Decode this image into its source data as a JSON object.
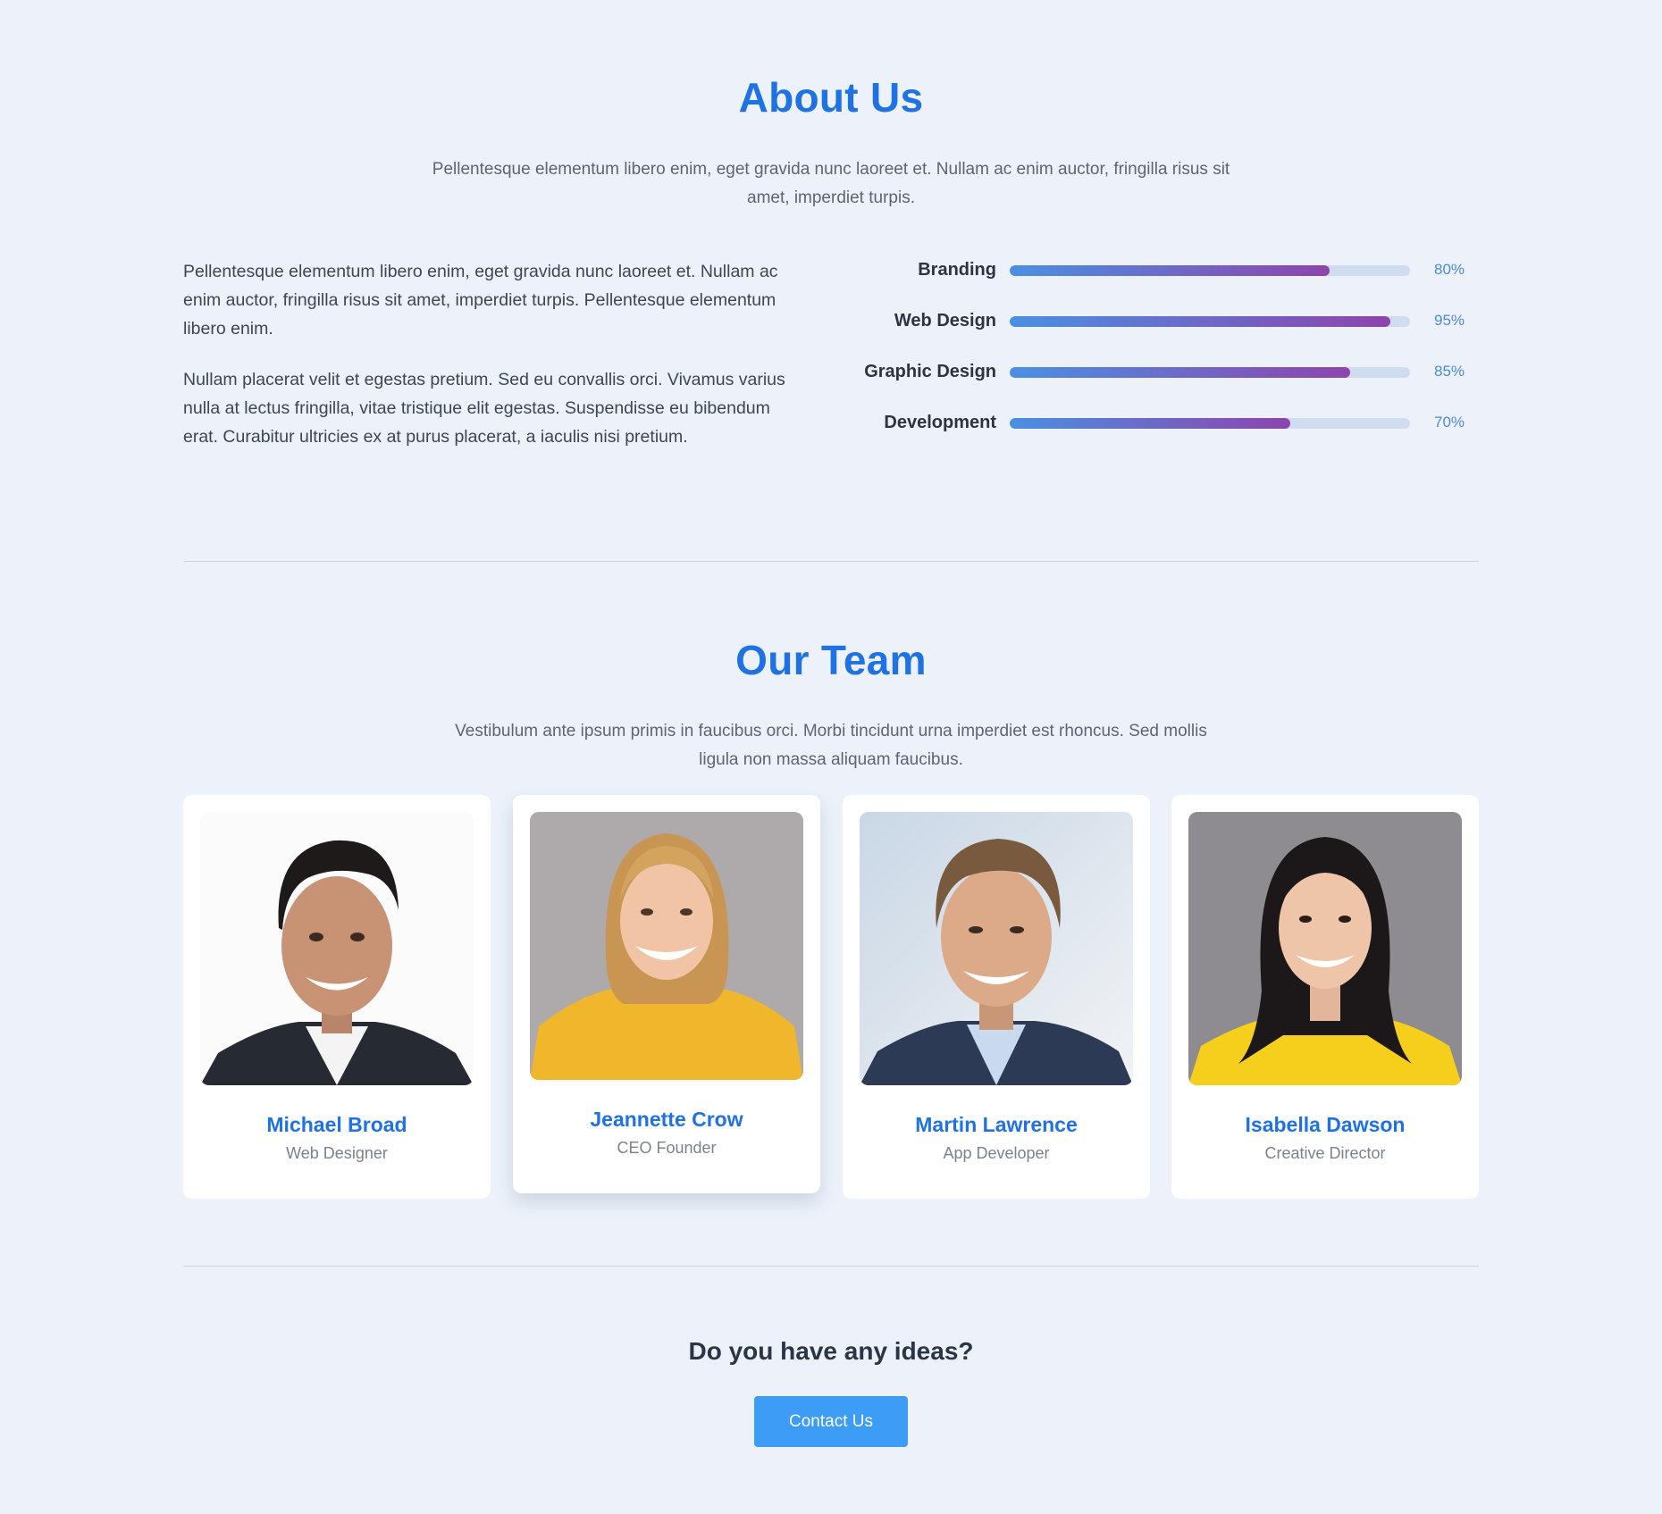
{
  "about": {
    "title": "About Us",
    "subtitle": "Pellentesque elementum libero enim, eget gravida nunc laoreet et. Nullam ac enim auctor, fringilla risus sit amet, imperdiet turpis.",
    "paragraphs": [
      "Pellentesque elementum libero enim, eget gravida nunc laoreet et. Nullam ac enim auctor, fringilla risus sit amet, imperdiet turpis. Pellentesque elementum libero enim.",
      "Nullam placerat velit et egestas pretium. Sed eu convallis orci. Vivamus varius nulla at lectus fringilla, vitae tristique elit egestas. Suspendisse eu bibendum erat. Curabitur ultricies ex at purus placerat, a iaculis nisi pretium."
    ],
    "skills": [
      {
        "label": "Branding",
        "percent_text": "80%",
        "value": 80
      },
      {
        "label": "Web Design",
        "percent_text": "95%",
        "value": 95
      },
      {
        "label": "Graphic Design",
        "percent_text": "85%",
        "value": 85
      },
      {
        "label": "Development",
        "percent_text": "70%",
        "value": 70
      }
    ],
    "bar_gradient": [
      "#4a90e2",
      "#8e44ad"
    ],
    "track_color": "#d0ddf1"
  },
  "team": {
    "title": "Our Team",
    "subtitle": "Vestibulum ante ipsum primis in faucibus orci. Morbi tincidunt urna imperdiet est rhoncus. Sed mollis ligula non massa aliquam faucibus.",
    "members": [
      {
        "name": "Michael Broad",
        "role": "Web Designer",
        "photo": "man-dark-hair-portrait"
      },
      {
        "name": "Jeannette Crow",
        "role": "CEO Founder",
        "photo": "woman-blonde-yellow-sweater-portrait"
      },
      {
        "name": "Martin Lawrence",
        "role": "App Developer",
        "photo": "man-brown-hair-suit-portrait"
      },
      {
        "name": "Isabella Dawson",
        "role": "Creative Director",
        "photo": "woman-black-hair-yellow-top-portrait"
      }
    ]
  },
  "cta": {
    "title": "Do you have any ideas?",
    "button_label": "Contact Us"
  },
  "colors": {
    "background": "#edf2fa",
    "heading_blue": "#1f72e4",
    "button_blue": "#3d9cf5",
    "card": "#ffffff"
  }
}
